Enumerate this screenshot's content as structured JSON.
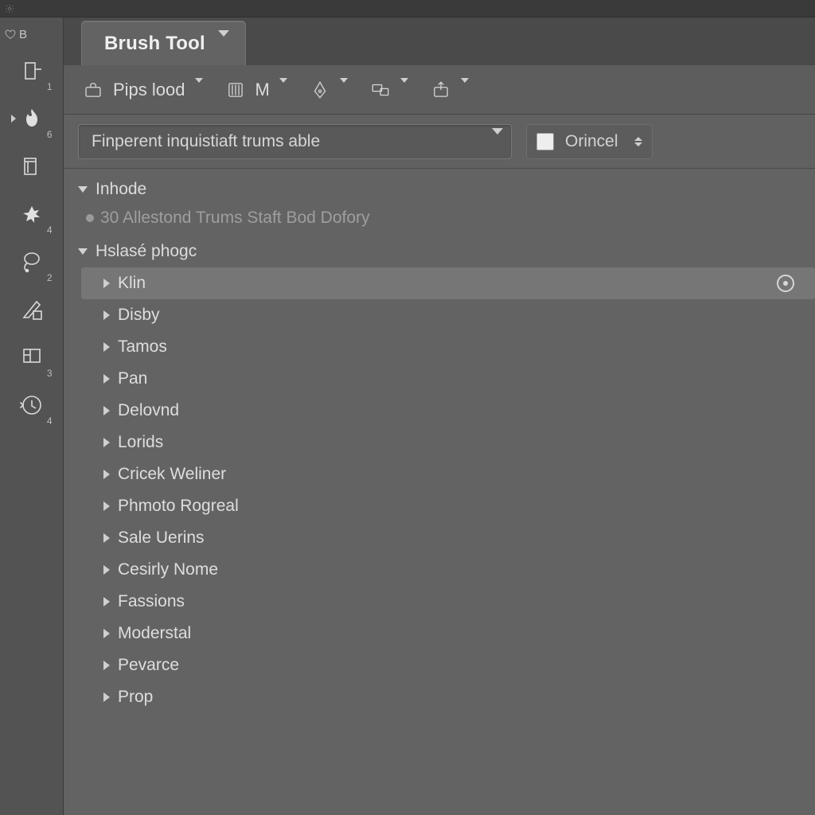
{
  "titlebar": {
    "gear_icon": "gear"
  },
  "sidebar": {
    "badge_label": "B",
    "tools": [
      {
        "id": "crop",
        "sub": "1"
      },
      {
        "id": "flame",
        "sub": "6"
      },
      {
        "id": "type",
        "sub": ""
      },
      {
        "id": "splat",
        "sub": "4"
      },
      {
        "id": "lasso",
        "sub": "2"
      },
      {
        "id": "slice",
        "sub": ""
      },
      {
        "id": "artboard",
        "sub": "3"
      },
      {
        "id": "history",
        "sub": "4"
      }
    ]
  },
  "tab": {
    "title": "Brush Tool"
  },
  "options": {
    "preset_label": "Pips lood",
    "mode_label": "M"
  },
  "filter": {
    "search_value": "Finperent inquistiaft trums able",
    "checkbox_label": "Orincel"
  },
  "tree": {
    "section1_label": "Inhode",
    "status_line": "30 Allestond Trums Staft Bod Dofory",
    "section2_label": "Hslasé phogc",
    "items": [
      {
        "label": "Klin",
        "selected": true
      },
      {
        "label": "Disby"
      },
      {
        "label": "Tamos"
      },
      {
        "label": "Pan"
      },
      {
        "label": "Delovnd"
      },
      {
        "label": "Lorids"
      },
      {
        "label": "Cricek Weliner"
      },
      {
        "label": "Phmoto Rogreal"
      },
      {
        "label": "Sale Uerins"
      },
      {
        "label": "Cesirly Nome"
      },
      {
        "label": "Fassions"
      },
      {
        "label": "Moderstal"
      },
      {
        "label": "Pevarce"
      },
      {
        "label": "Prop"
      }
    ]
  }
}
